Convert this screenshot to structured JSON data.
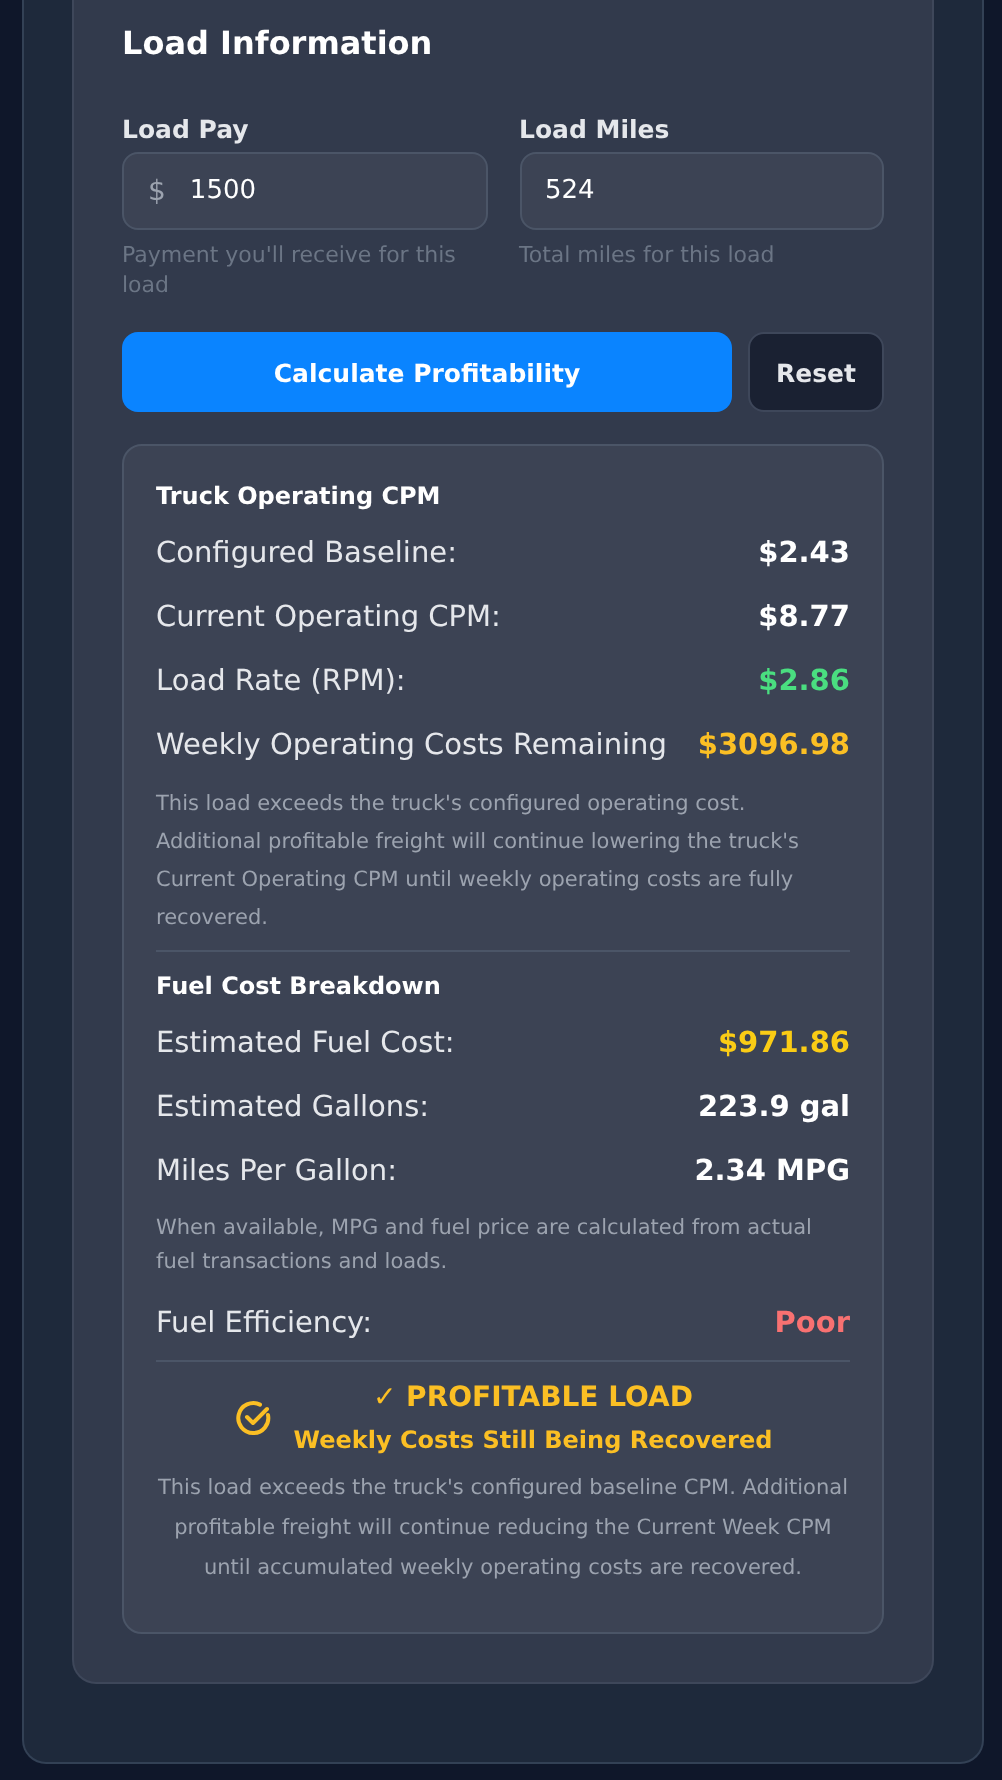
{
  "section_title": "Load Information",
  "fields": [
    {
      "label": "Load Pay",
      "prefix": "$",
      "value": "1500",
      "hint": "Payment you'll receive for this load"
    },
    {
      "label": "Load Miles",
      "value": "524",
      "hint": "Total miles for this load"
    }
  ],
  "buttons": {
    "primary": "Calculate Profitability",
    "secondary": "Reset"
  },
  "results": {
    "groups": [
      {
        "title": "Truck Operating CPM",
        "rows": [
          {
            "label": "Configured Baseline:",
            "value": "$2.43",
            "color": "#ffffff"
          },
          {
            "label": "Current Operating CPM:",
            "value": "$8.77",
            "color": "#ffffff"
          },
          {
            "label": "Load Rate (RPM):",
            "value": "$2.86",
            "color": "#4ade80"
          },
          {
            "label": "Weekly Operating Costs Remaining",
            "value": "$3096.98",
            "color": "#fbbf24"
          }
        ],
        "note": "This load exceeds the truck's configured operating cost. Additional profitable freight will continue lowering the truck's Current Operating CPM until weekly operating costs are fully recovered."
      },
      {
        "title": "Fuel Cost Breakdown",
        "rows": [
          {
            "label": "Estimated Fuel Cost:",
            "value": "$971.86",
            "color": "#facc15"
          },
          {
            "label": "Estimated Gallons:",
            "value": "223.9 gal",
            "color": "#ffffff"
          },
          {
            "label": "Miles Per Gallon:",
            "value": "2.34 MPG",
            "color": "#ffffff"
          }
        ],
        "note": "When available, MPG and fuel price are calculated from actual fuel transactions and loads.",
        "extra_rows": [
          {
            "label": "Fuel Efficiency:",
            "value": "Poor",
            "color": "#f87171"
          }
        ]
      }
    ],
    "verdict": {
      "title": "✓ PROFITABLE LOAD",
      "subtitle": "Weekly Costs Still Being Recovered",
      "text": "This load exceeds the truck's configured baseline CPM. Additional profitable freight will continue reducing the Current Week CPM until accumulated weekly operating costs are recovered."
    }
  }
}
